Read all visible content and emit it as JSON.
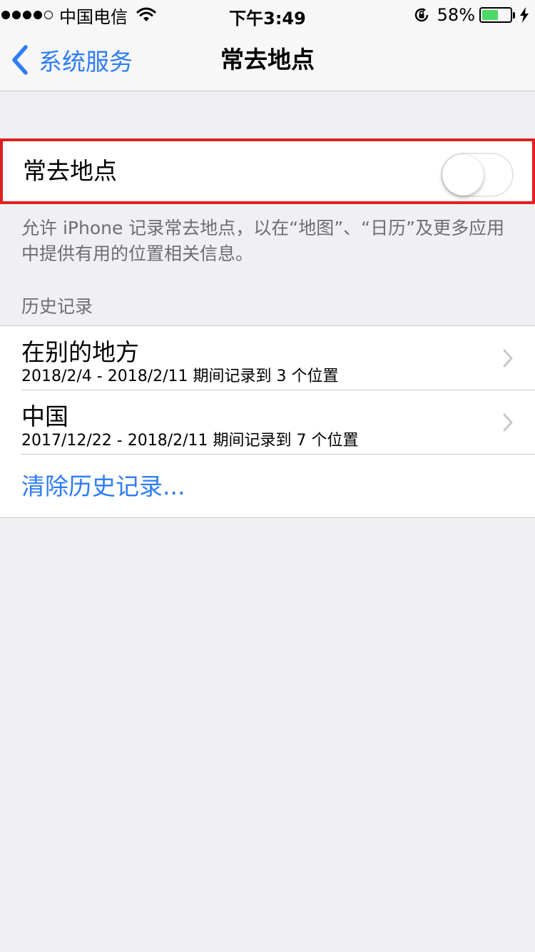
{
  "status_bar": {
    "carrier": "中国电信",
    "time": "下午3:49",
    "battery_percent": "58%",
    "battery_level": 0.58,
    "colors": {
      "battery_fill": "#4cd964"
    }
  },
  "nav": {
    "back_label": "系统服务",
    "title": "常去地点"
  },
  "toggle": {
    "label": "常去地点",
    "state": "off"
  },
  "footer_note": "允许 iPhone 记录常去地点，以在“地图”、“日历”及更多应用中提供有用的位置相关信息。",
  "history": {
    "header": "历史记录",
    "items": [
      {
        "title": "在别的地方",
        "subtitle": "2018/2/4 - 2018/2/11 期间记录到 3 个位置"
      },
      {
        "title": "中国",
        "subtitle": "2017/12/22 - 2018/2/11 期间记录到 7 个位置"
      }
    ],
    "clear_label": "清除历史记录..."
  },
  "colors": {
    "accent": "#2e7cf6",
    "highlight_border": "#e02020",
    "background": "#efeff4"
  },
  "icons": [
    "wifi-icon",
    "rotation-lock-icon",
    "battery-icon",
    "charging-bolt-icon",
    "back-chevron-icon",
    "chevron-right-icon"
  ]
}
